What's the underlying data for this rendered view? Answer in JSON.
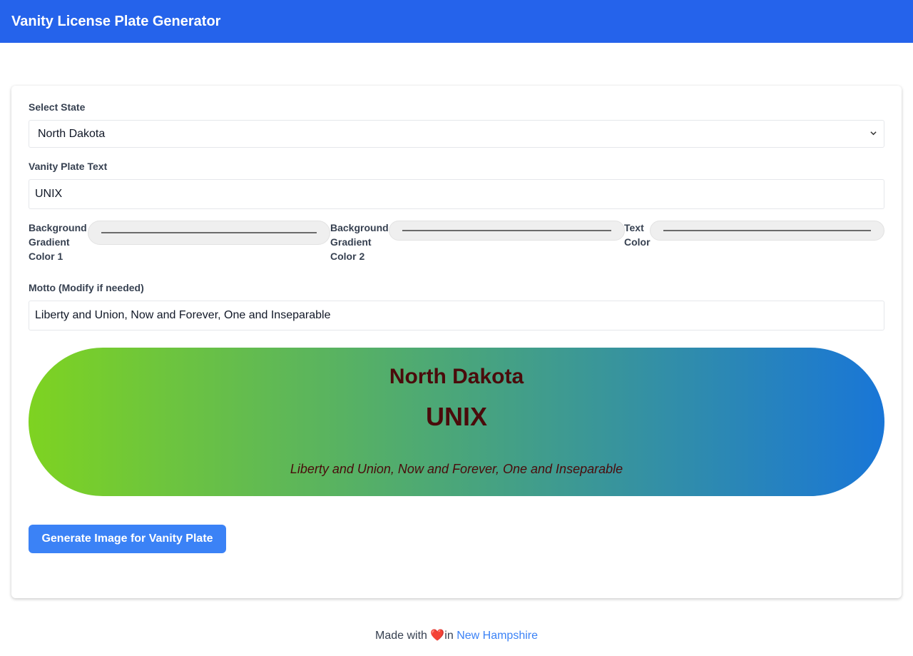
{
  "header": {
    "title": "Vanity License Plate Generator"
  },
  "form": {
    "state_label": "Select State",
    "state_value": "North Dakota",
    "plate_text_label": "Vanity Plate Text",
    "plate_text_value": "UNIX",
    "color1_label_lines": [
      "Background",
      "Gradient",
      "Color 1"
    ],
    "color2_label_lines": [
      "Background",
      "Gradient",
      "Color 2"
    ],
    "text_color_label_lines": [
      "Text",
      "Color"
    ],
    "motto_label": "Motto (Modify if needed)",
    "motto_value": "Liberty and Union, Now and Forever, One and Inseparable"
  },
  "colors": {
    "header_bg": "#2563eb",
    "gradient_color_1": "#7ed321",
    "gradient_color_2": "#1976d7",
    "plate_text_color": "#4a0b0b",
    "button_bg": "#3b82f6"
  },
  "plate": {
    "state": "North Dakota",
    "text": "UNIX",
    "motto": "Liberty and Union, Now and Forever, One and Inseparable"
  },
  "actions": {
    "generate_label": "Generate Image for Vanity Plate"
  },
  "footer": {
    "made_with": "Made with",
    "heart": "❤️",
    "in": "in",
    "link_text": "New Hampshire"
  }
}
